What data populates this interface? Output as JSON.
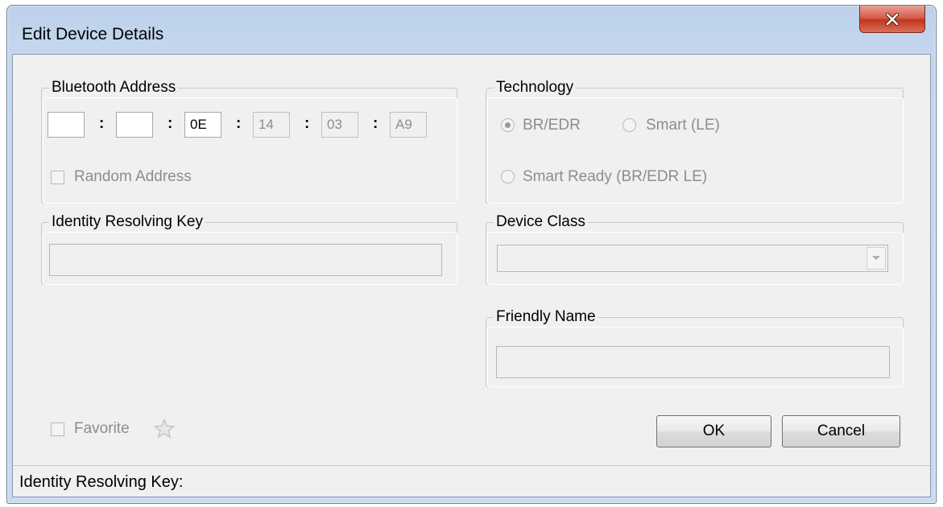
{
  "window": {
    "title": "Edit Device Details",
    "close_icon": "close-icon"
  },
  "bluetooth_address": {
    "legend": "Bluetooth Address",
    "octets": [
      "",
      "",
      "0E",
      "14",
      "03",
      "A9"
    ],
    "separator": ":",
    "random_address_label": "Random Address",
    "random_address_checked": false
  },
  "technology": {
    "legend": "Technology",
    "options": [
      {
        "label": "BR/EDR",
        "selected": true
      },
      {
        "label": "Smart (LE)",
        "selected": false
      },
      {
        "label": "Smart Ready (BR/EDR  LE)",
        "selected": false
      }
    ]
  },
  "identity_resolving_key": {
    "legend": "Identity Resolving Key",
    "value": ""
  },
  "device_class": {
    "legend": "Device Class",
    "selected": ""
  },
  "friendly_name": {
    "legend": "Friendly Name",
    "value": ""
  },
  "favorite": {
    "label": "Favorite",
    "checked": false,
    "icon": "star-icon"
  },
  "buttons": {
    "ok_label": "OK",
    "cancel_label": "Cancel"
  },
  "status_bar": {
    "text": "Identity Resolving Key:"
  }
}
